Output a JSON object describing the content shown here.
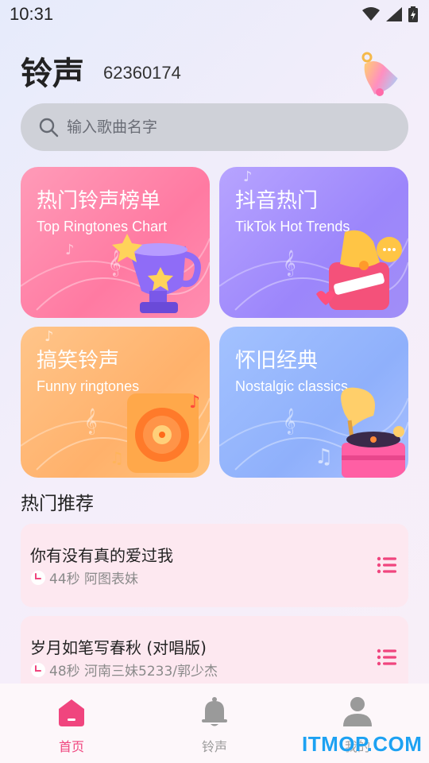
{
  "status_bar": {
    "time": "10:31"
  },
  "header": {
    "title": "铃声",
    "subtitle": "62360174"
  },
  "search": {
    "placeholder": "输入歌曲名字"
  },
  "cards": [
    {
      "title": "热门铃声榜单",
      "subtitle": "Top Ringtones Chart",
      "art_icon": "trophy-icon"
    },
    {
      "title": "抖音热门",
      "subtitle": "TikTok Hot Trends",
      "art_icon": "subscribe-bell-icon"
    },
    {
      "title": "搞笑铃声",
      "subtitle": "Funny ringtones",
      "art_icon": "speaker-icon"
    },
    {
      "title": "怀旧经典",
      "subtitle": "Nostalgic classics",
      "art_icon": "gramophone-icon"
    }
  ],
  "section": {
    "title": "热门推荐"
  },
  "songs": [
    {
      "title": "你有没有真的爱过我",
      "meta": "44秒 阿图表妹"
    },
    {
      "title": "岁月如笔写春秋 (对唱版)",
      "meta": "48秒 河南三妹5233/郭少杰"
    }
  ],
  "bottom_nav": {
    "items": [
      {
        "label": "首页",
        "icon": "home-icon",
        "active": true
      },
      {
        "label": "铃声",
        "icon": "bell-icon",
        "active": false
      },
      {
        "label": "我的",
        "icon": "profile-icon",
        "active": false
      }
    ]
  },
  "watermark": "ITMOP.COM",
  "colors": {
    "accent": "#f0457e",
    "inactive": "#9a9a9a",
    "song_card": "#fde8f0"
  }
}
